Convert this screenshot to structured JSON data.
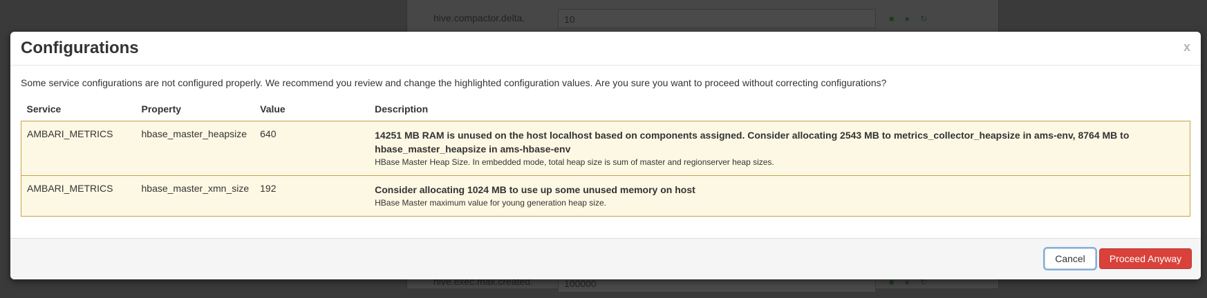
{
  "background": {
    "top_row": {
      "label": "hive.compactor.delta.",
      "value": "10"
    },
    "bottom_row": {
      "label": "hive.exec.max.created.",
      "value": "100000"
    },
    "icons": [
      "lock-icon",
      "plus-circle-icon",
      "refresh-icon"
    ]
  },
  "modal": {
    "title": "Configurations",
    "close_label": "x",
    "intro": "Some service configurations are not configured properly. We recommend you review and change the highlighted configuration values. Are you sure you want to proceed without correcting configurations?",
    "table": {
      "headers": [
        "Service",
        "Property",
        "Value",
        "Description"
      ],
      "rows": [
        {
          "service": "AMBARI_METRICS",
          "property": "hbase_master_heapsize",
          "value": "640",
          "warning": "14251 MB RAM is unused on the host localhost based on components assigned. Consider allocating 2543 MB to metrics_collector_heapsize in ams-env, 8764 MB to hbase_master_heapsize in ams-hbase-env",
          "description": "HBase Master Heap Size. In embedded mode, total heap size is sum of master and regionserver heap sizes."
        },
        {
          "service": "AMBARI_METRICS",
          "property": "hbase_master_xmn_size",
          "value": "192",
          "warning": "Consider allocating 1024 MB to use up some unused memory on host",
          "description": "HBase Master maximum value for young generation heap size."
        }
      ]
    },
    "footer": {
      "cancel_label": "Cancel",
      "proceed_label": "Proceed Anyway"
    }
  },
  "colors": {
    "warning_row_bg": "#fcf8e3",
    "warning_border": "#c9a04a",
    "danger_button": "#d9413a",
    "focus_ring": "#7ab0e6"
  }
}
